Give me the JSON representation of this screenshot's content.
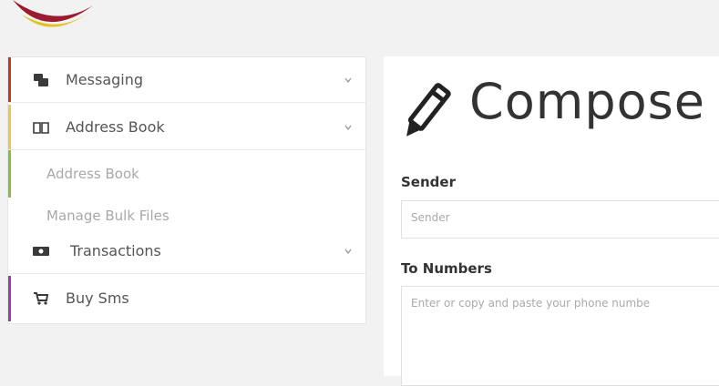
{
  "sidebar": {
    "items": [
      {
        "label": "Messaging",
        "icon": "chat-bubbles-icon",
        "accent": "#c0392b"
      },
      {
        "label": "Address Book",
        "icon": "open-book-icon",
        "accent": "#e8c94a"
      },
      {
        "label": "Transactions",
        "icon": "money-icon",
        "accent": "#ffffff"
      },
      {
        "label": "Buy Sms",
        "icon": "cart-icon",
        "accent": "#9b3fa6"
      }
    ],
    "subitems": [
      {
        "label": "Address Book"
      },
      {
        "label": "Manage Bulk Files"
      }
    ],
    "subitems_accent": "#8bbd3d"
  },
  "compose": {
    "title": "Compose",
    "icon": "pencil-icon"
  },
  "form": {
    "sender_label": "Sender",
    "sender_placeholder": "Sender",
    "numbers_label": "To Numbers",
    "numbers_placeholder": "Enter or copy and paste your phone numbe"
  }
}
